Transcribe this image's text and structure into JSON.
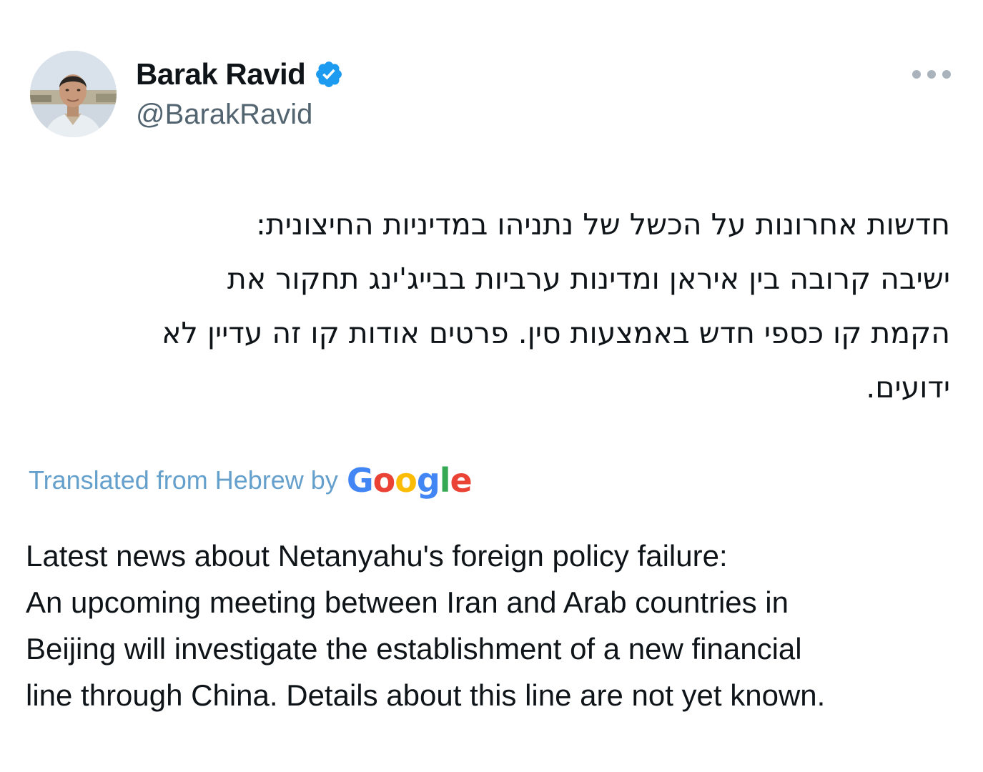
{
  "author": {
    "display_name": "Barak Ravid",
    "handle": "@BarakRavid",
    "verified": true
  },
  "tweet": {
    "original_lines": [
      "חדשות אחרונות על הכשל של נתניהו במדיניות החיצונית:",
      "ישיבה קרובה בין איראן ומדינות ערביות בבייג'ינג תחקור את",
      "הקמת קו כספי חדש באמצעות סין. פרטים אודות קו זה עדיין לא",
      "ידועים."
    ],
    "translation_label": "Translated from Hebrew by",
    "translation_provider": "Google",
    "translated_lines": [
      "Latest news about Netanyahu's foreign policy failure:",
      "An upcoming meeting between Iran and Arab countries in",
      "Beijing will investigate the establishment of a new financial",
      "line through China. Details about this line are not yet known."
    ]
  },
  "icons": {
    "verified": "verified-badge-icon",
    "more": "more-options-icon"
  },
  "colors": {
    "verified_blue": "#1d9bf0",
    "handle_gray": "#536471",
    "translate_link": "#4a90c2",
    "text": "#0f1419"
  }
}
